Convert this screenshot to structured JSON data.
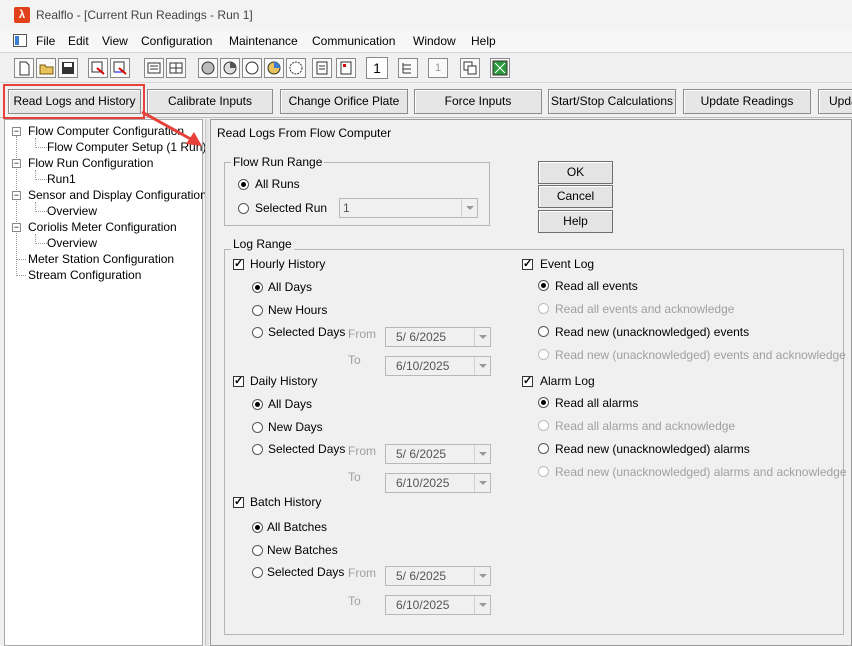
{
  "window": {
    "title": "Realflo - [Current Run Readings - Run 1]"
  },
  "menu": [
    "File",
    "Edit",
    "View",
    "Configuration",
    "Maintenance",
    "Communication",
    "Window",
    "Help"
  ],
  "toolbar": {
    "run_number": "1",
    "run_number_disabled": "1"
  },
  "buttons": {
    "read_logs": "Read Logs and History",
    "calibrate": "Calibrate Inputs",
    "change_orifice": "Change Orifice Plate",
    "force_inputs": "Force Inputs",
    "start_stop": "Start/Stop Calculations",
    "update_readings": "Update Readings",
    "update_cut": "Upda"
  },
  "tree": {
    "flow_computer_config": "Flow Computer Configuration",
    "flow_computer_setup": "Flow Computer Setup (1 Run)",
    "flow_run_config": "Flow Run Configuration",
    "run1": "Run1",
    "sensor_display_config": "Sensor and Display Configuration",
    "overview1": "Overview",
    "coriolis_config": "Coriolis Meter Configuration",
    "overview2": "Overview",
    "meter_station_config": "Meter Station Configuration",
    "stream_config": "Stream Configuration"
  },
  "panel": {
    "title": "Read Logs From Flow Computer",
    "flow_run_range": {
      "title": "Flow Run Range",
      "all_runs": "All Runs",
      "selected_run": "Selected Run",
      "selected_run_value": "1"
    },
    "dialog_buttons": {
      "ok": "OK",
      "cancel": "Cancel",
      "help": "Help"
    },
    "log_range": {
      "title": "Log Range",
      "from_label": "From",
      "to_label": "To",
      "hourly": {
        "label": "Hourly History",
        "all": "All Days",
        "new": "New Hours",
        "selected": "Selected Days",
        "from": "5/  6/2025",
        "to": "6/10/2025"
      },
      "daily": {
        "label": "Daily History",
        "all": "All Days",
        "new": "New Days",
        "selected": "Selected Days",
        "from": "5/  6/2025",
        "to": "6/10/2025"
      },
      "batch": {
        "label": "Batch History",
        "all": "All Batches",
        "new": "New Batches",
        "selected": "Selected Days",
        "from": "5/  6/2025",
        "to": "6/10/2025"
      },
      "event_log": {
        "label": "Event Log",
        "read_all": "Read all events",
        "read_all_ack": "Read all events and acknowledge",
        "read_new": "Read new (unacknowledged) events",
        "read_new_ack": "Read new (unacknowledged) events and acknowledge"
      },
      "alarm_log": {
        "label": "Alarm Log",
        "read_all": "Read all alarms",
        "read_all_ack": "Read all alarms and acknowledge",
        "read_new": "Read new (unacknowledged) alarms",
        "read_new_ack": "Read new (unacknowledged) alarms and acknowledge"
      }
    }
  },
  "colors": {
    "highlight": "#e8413a",
    "disabled_text": "#a0a0a0"
  }
}
